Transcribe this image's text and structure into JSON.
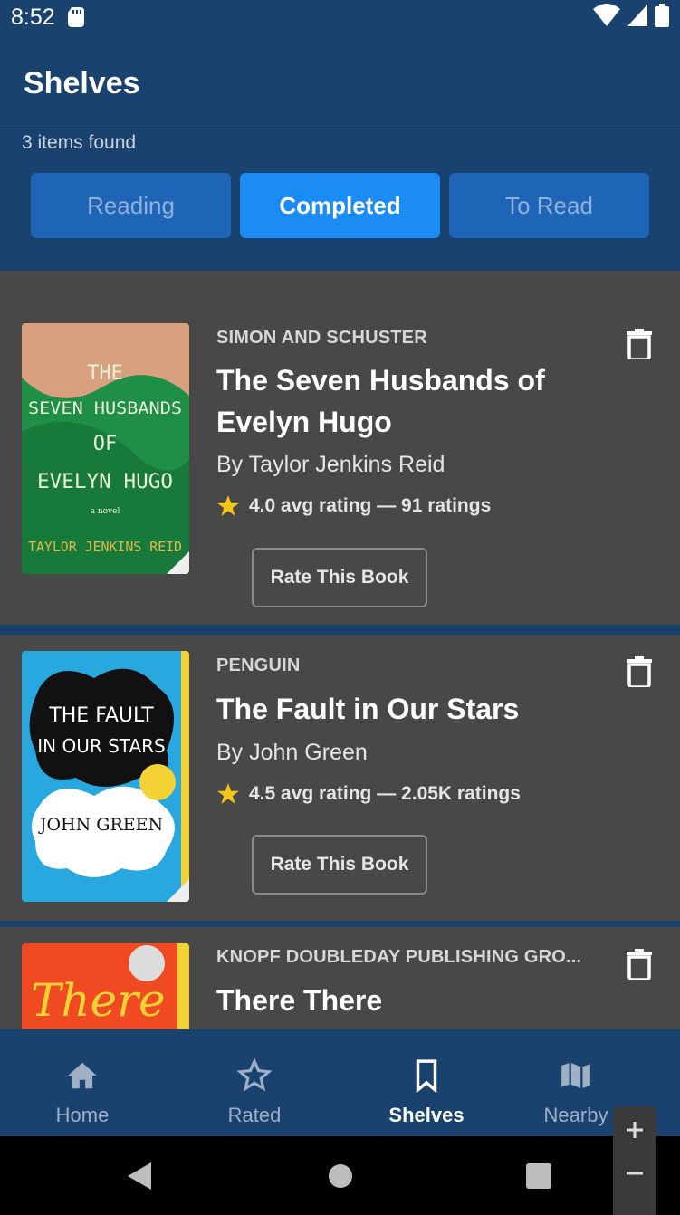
{
  "status": {
    "time": "8:52"
  },
  "app": {
    "title": "Shelves",
    "result_count": "3 items found"
  },
  "tabs": [
    {
      "label": "Reading",
      "active": false
    },
    {
      "label": "Completed",
      "active": true
    },
    {
      "label": "To Read",
      "active": false
    }
  ],
  "books": [
    {
      "publisher": "SIMON AND SCHUSTER",
      "title": "The Seven Husbands of Evelyn Hugo",
      "author": "By Taylor Jenkins Reid",
      "rating": "4.0 avg rating — 91 ratings",
      "rate_label": "Rate This Book",
      "cover": {
        "l1": "THE",
        "l2": "SEVEN HUSBANDS",
        "l3": "OF",
        "l4": "EVELYN HUGO",
        "l5": "a novel",
        "l6": "TAYLOR JENKINS REID"
      }
    },
    {
      "publisher": "PENGUIN",
      "title": "The Fault in Our Stars",
      "author": "By John Green",
      "rating": "4.5 avg rating — 2.05K ratings",
      "rate_label": "Rate This Book",
      "cover": {
        "l1": "THE FAULT",
        "l2": "IN OUR STARS",
        "l3": "JOHN GREEN"
      }
    },
    {
      "publisher": "KNOPF DOUBLEDAY PUBLISHING GRO...",
      "title": "There There",
      "cover": {
        "l1": "There"
      }
    }
  ],
  "nav": [
    {
      "label": "Home",
      "icon": "home-icon"
    },
    {
      "label": "Rated",
      "icon": "star-outline-icon"
    },
    {
      "label": "Shelves",
      "icon": "bookmark-icon",
      "active": true
    },
    {
      "label": "Nearby",
      "icon": "map-icon"
    }
  ],
  "colors": {
    "primary": "#1a426e",
    "accent": "#1c8cf5",
    "card": "#484848",
    "star": "#f5c518"
  }
}
